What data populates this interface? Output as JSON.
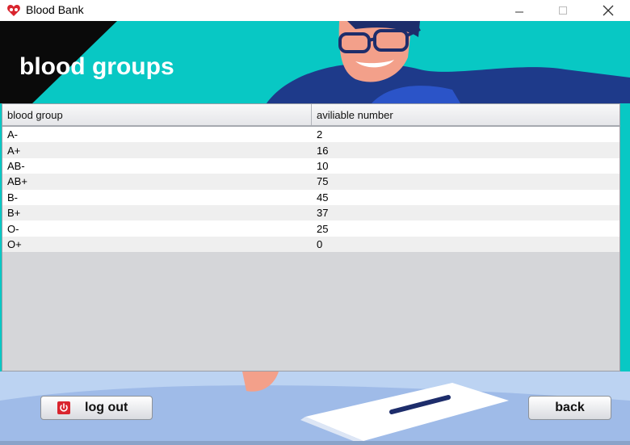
{
  "window": {
    "title": "Blood Bank",
    "icon": "blood-bank-heart-icon"
  },
  "page": {
    "title": "blood groups"
  },
  "table": {
    "columns": [
      "blood group",
      "aviliable number"
    ],
    "rows": [
      {
        "group": "A-",
        "number": "2"
      },
      {
        "group": "A+",
        "number": "16"
      },
      {
        "group": "AB-",
        "number": "10"
      },
      {
        "group": "AB+",
        "number": "75"
      },
      {
        "group": "B-",
        "number": "45"
      },
      {
        "group": "B+",
        "number": "37"
      },
      {
        "group": "O-",
        "number": "25"
      },
      {
        "group": "O+",
        "number": "0"
      }
    ]
  },
  "buttons": {
    "logout": "log out",
    "back": "back"
  },
  "colors": {
    "background": "#08c8c4",
    "accent_red": "#d9252e"
  }
}
